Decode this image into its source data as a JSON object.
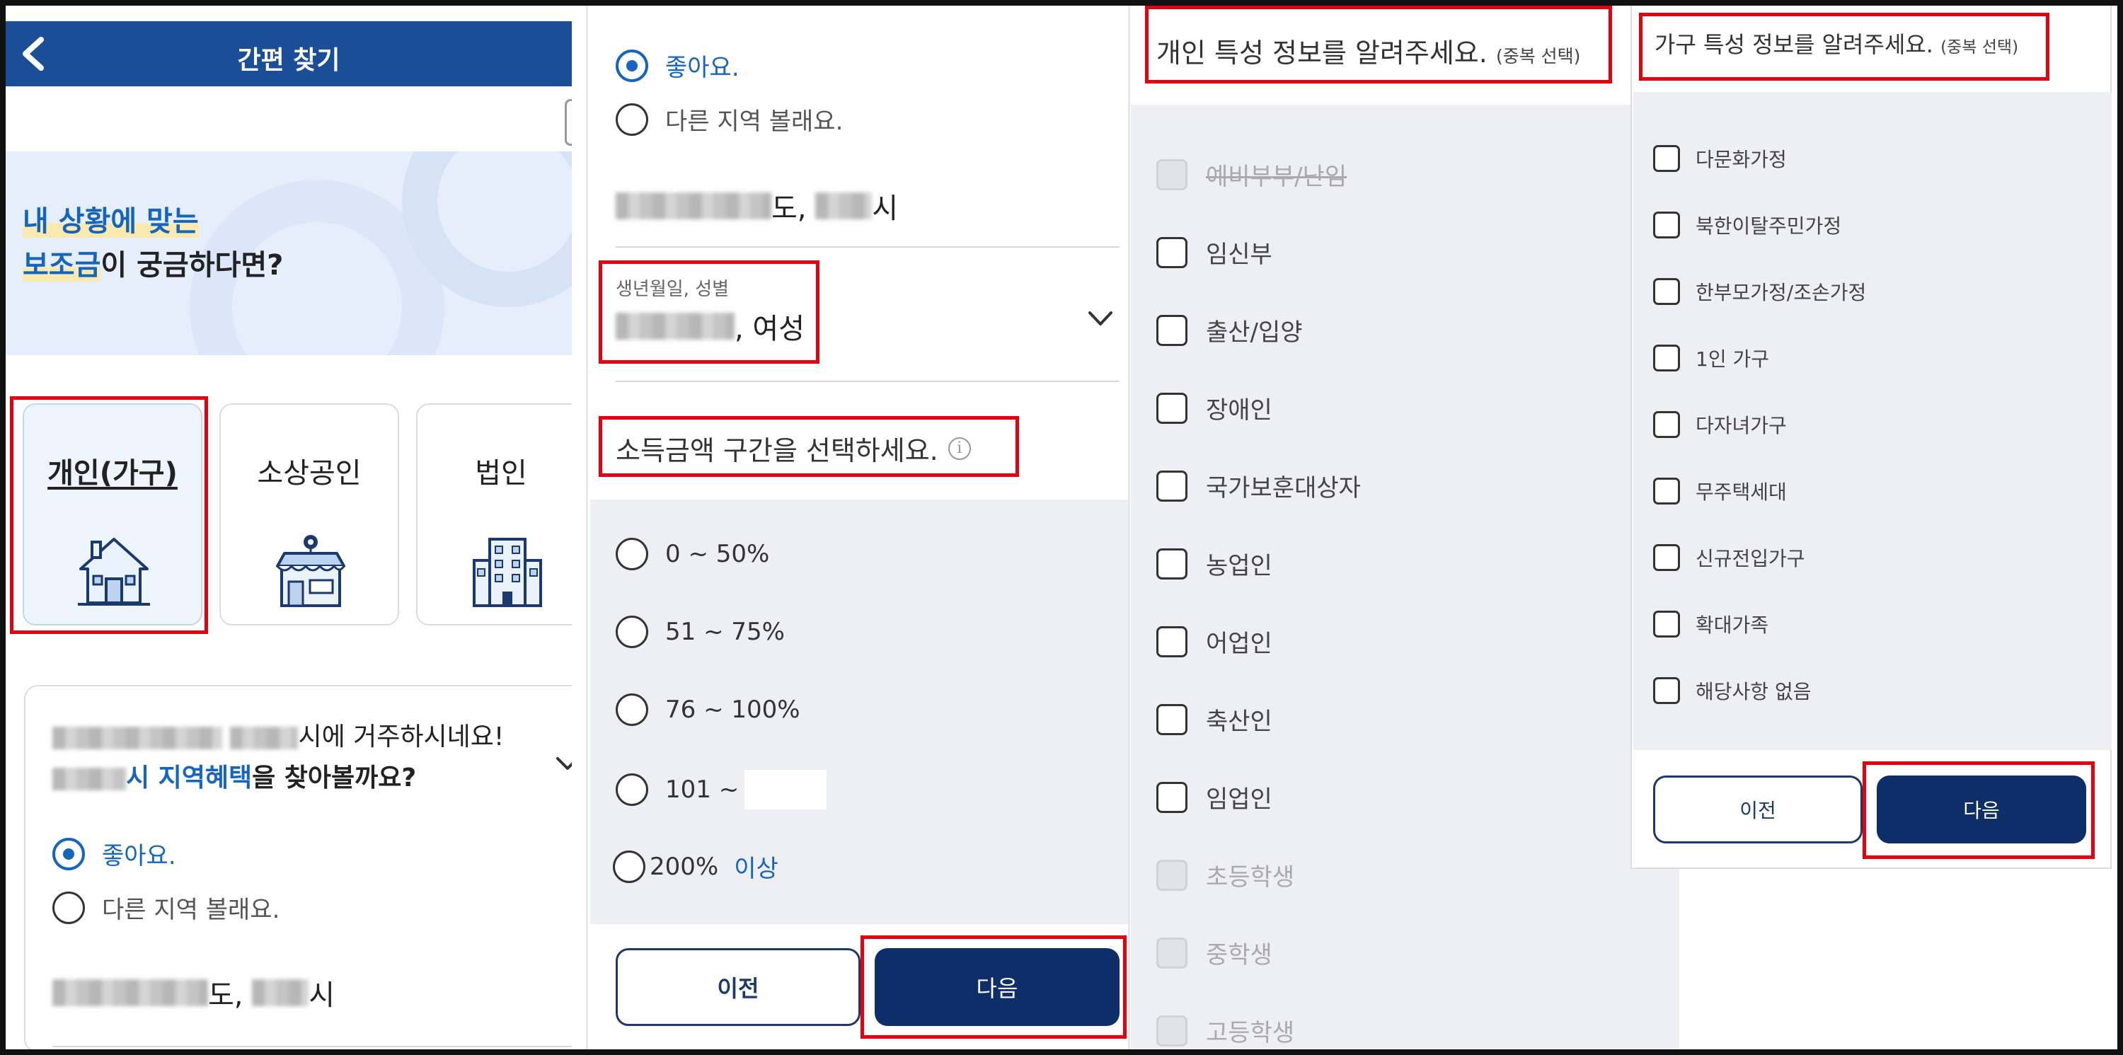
{
  "panel1": {
    "title": "간편 찾기",
    "banner_line1": "내 상황에 맞는",
    "banner_line2_highlight": "보조금",
    "banner_line2_rest": "이 궁금하다면?",
    "categories": [
      {
        "label": "개인(가구)",
        "icon": "house-icon"
      },
      {
        "label": "소상공인",
        "icon": "storefront-icon"
      },
      {
        "label": "법인",
        "icon": "office-building-icon"
      }
    ],
    "region_card": {
      "line1_suffix": "시에 거주하시네요!",
      "line2_highlight": "시 지역혜택",
      "line2_rest": "을 찾아볼까요?",
      "option_yes": "좋아요.",
      "option_other": "다른 지역 볼래요.",
      "address_do": "도,",
      "address_si": "시"
    }
  },
  "panel2": {
    "option_yes": "좋아요.",
    "option_other": "다른 지역 볼래요.",
    "address_do": "도,",
    "address_si": "시",
    "birth_label": "생년월일, 성별",
    "birth_value_suffix": ", 여성",
    "income_title": "소득금액 구간을 선택하세요.",
    "income_options": [
      "0 ~ 50%",
      "51 ~ 75%",
      "76 ~ 100%",
      "101 ~",
      "200%"
    ],
    "income_last_suffix": "이상",
    "prev_button": "이전",
    "next_button": "다음"
  },
  "panel3": {
    "title": "개인 특성 정보를 알려주세요.",
    "title_note": "(중복 선택)",
    "items": [
      {
        "label": "예비부부/난임",
        "disabled": true
      },
      {
        "label": "임신부",
        "disabled": false
      },
      {
        "label": "출산/입양",
        "disabled": false
      },
      {
        "label": "장애인",
        "disabled": false
      },
      {
        "label": "국가보훈대상자",
        "disabled": false
      },
      {
        "label": "농업인",
        "disabled": false
      },
      {
        "label": "어업인",
        "disabled": false
      },
      {
        "label": "축산인",
        "disabled": false
      },
      {
        "label": "임업인",
        "disabled": false
      },
      {
        "label": "초등학생",
        "disabled": true
      },
      {
        "label": "중학생",
        "disabled": true
      },
      {
        "label": "고등학생",
        "disabled": true
      }
    ]
  },
  "panel4": {
    "title": "가구 특성 정보를 알려주세요.",
    "title_note": "(중복 선택)",
    "items": [
      "다문화가정",
      "북한이탈주민가정",
      "한부모가정/조손가정",
      "1인 가구",
      "다자녀가구",
      "무주택세대",
      "신규전입가구",
      "확대가족",
      "해당사항 없음"
    ],
    "prev_button": "이전",
    "next_button": "다음"
  },
  "colors": {
    "primary_blue": "#1a4e96",
    "accent_blue": "#1565c0",
    "button_navy": "#0e2e6a",
    "highlight_red": "#e3000f",
    "panel_gray": "#eeeff3"
  }
}
